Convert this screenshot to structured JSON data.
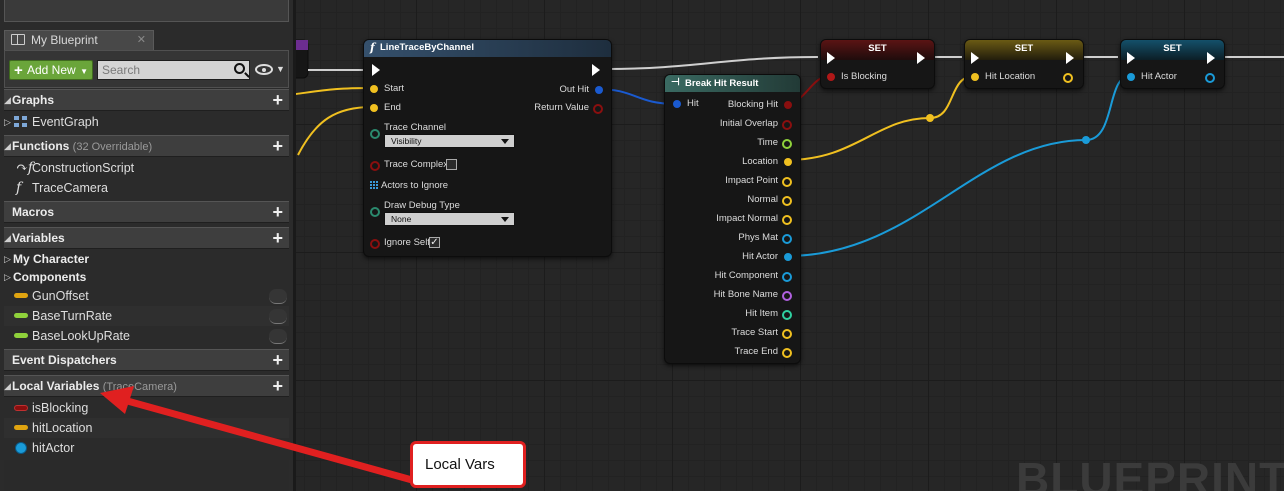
{
  "panel": {
    "tab_label": "My Blueprint",
    "add_new_label": "Add New",
    "search_placeholder": "Search",
    "sections": {
      "graphs": "Graphs",
      "functions": "Functions",
      "functions_extra": "(32 Overridable)",
      "macros": "Macros",
      "variables": "Variables",
      "event_dispatchers": "Event Dispatchers",
      "local_variables": "Local Variables",
      "local_variables_extra": "(TraceCamera)"
    },
    "graphs": [
      "EventGraph"
    ],
    "functions": [
      "ConstructionScript",
      "TraceCamera"
    ],
    "variable_categories": [
      "My Character",
      "Components"
    ],
    "variables": [
      {
        "name": "GunOffset",
        "color": "#e0a410"
      },
      {
        "name": "BaseTurnRate",
        "color": "#8fd13b"
      },
      {
        "name": "BaseLookUpRate",
        "color": "#8fd13b"
      }
    ],
    "local_variables": [
      {
        "name": "isBlocking",
        "color": "#8a0f0f"
      },
      {
        "name": "hitLocation",
        "color": "#e0a410"
      },
      {
        "name": "hitActor",
        "color": "#1a9bd8"
      }
    ]
  },
  "nodes": {
    "line_trace": {
      "title": "LineTraceByChannel",
      "pins": {
        "start": "Start",
        "end": "End",
        "trace_channel": "Trace Channel",
        "trace_channel_value": "Visibility",
        "trace_complex": "Trace Complex",
        "actors_to_ignore": "Actors to Ignore",
        "draw_debug_type": "Draw Debug Type",
        "draw_debug_value": "None",
        "ignore_self": "Ignore Self",
        "out_hit": "Out Hit",
        "return_value": "Return Value"
      },
      "trace_complex_checked": false,
      "ignore_self_checked": true
    },
    "break_hit": {
      "title": "Break Hit Result",
      "input": "Hit",
      "outputs": [
        {
          "label": "Blocking Hit",
          "color": "#8a0f0f",
          "filled": true
        },
        {
          "label": "Initial Overlap",
          "color": "#8a0f0f",
          "filled": false
        },
        {
          "label": "Time",
          "color": "#8fd13b",
          "filled": false
        },
        {
          "label": "Location",
          "color": "#f0c020",
          "filled": true
        },
        {
          "label": "Impact Point",
          "color": "#f0c020",
          "filled": false
        },
        {
          "label": "Normal",
          "color": "#f0c020",
          "filled": false
        },
        {
          "label": "Impact Normal",
          "color": "#f0c020",
          "filled": false
        },
        {
          "label": "Phys Mat",
          "color": "#1a9bd8",
          "filled": false
        },
        {
          "label": "Hit Actor",
          "color": "#1a9bd8",
          "filled": true
        },
        {
          "label": "Hit Component",
          "color": "#1a9bd8",
          "filled": false
        },
        {
          "label": "Hit Bone Name",
          "color": "#b060e0",
          "filled": false
        },
        {
          "label": "Hit Item",
          "color": "#2fd0a0",
          "filled": false
        },
        {
          "label": "Trace Start",
          "color": "#f0c020",
          "filled": false
        },
        {
          "label": "Trace End",
          "color": "#f0c020",
          "filled": false
        }
      ]
    },
    "set_blocking": {
      "title": "SET",
      "pin": "Is Blocking",
      "color": "#b01818"
    },
    "set_location": {
      "title": "SET",
      "pin": "Hit Location",
      "color": "#f0c020"
    },
    "set_actor": {
      "title": "SET",
      "pin": "Hit Actor",
      "color": "#1a9bd8"
    }
  },
  "watermark": "BLUEPRINT",
  "callout": "Local Vars",
  "colors": {
    "exec": "#ffffff",
    "vector": "#f0c020",
    "object": "#1a9bd8",
    "bool": "#8a0f0f",
    "annotation": "#e02020"
  }
}
